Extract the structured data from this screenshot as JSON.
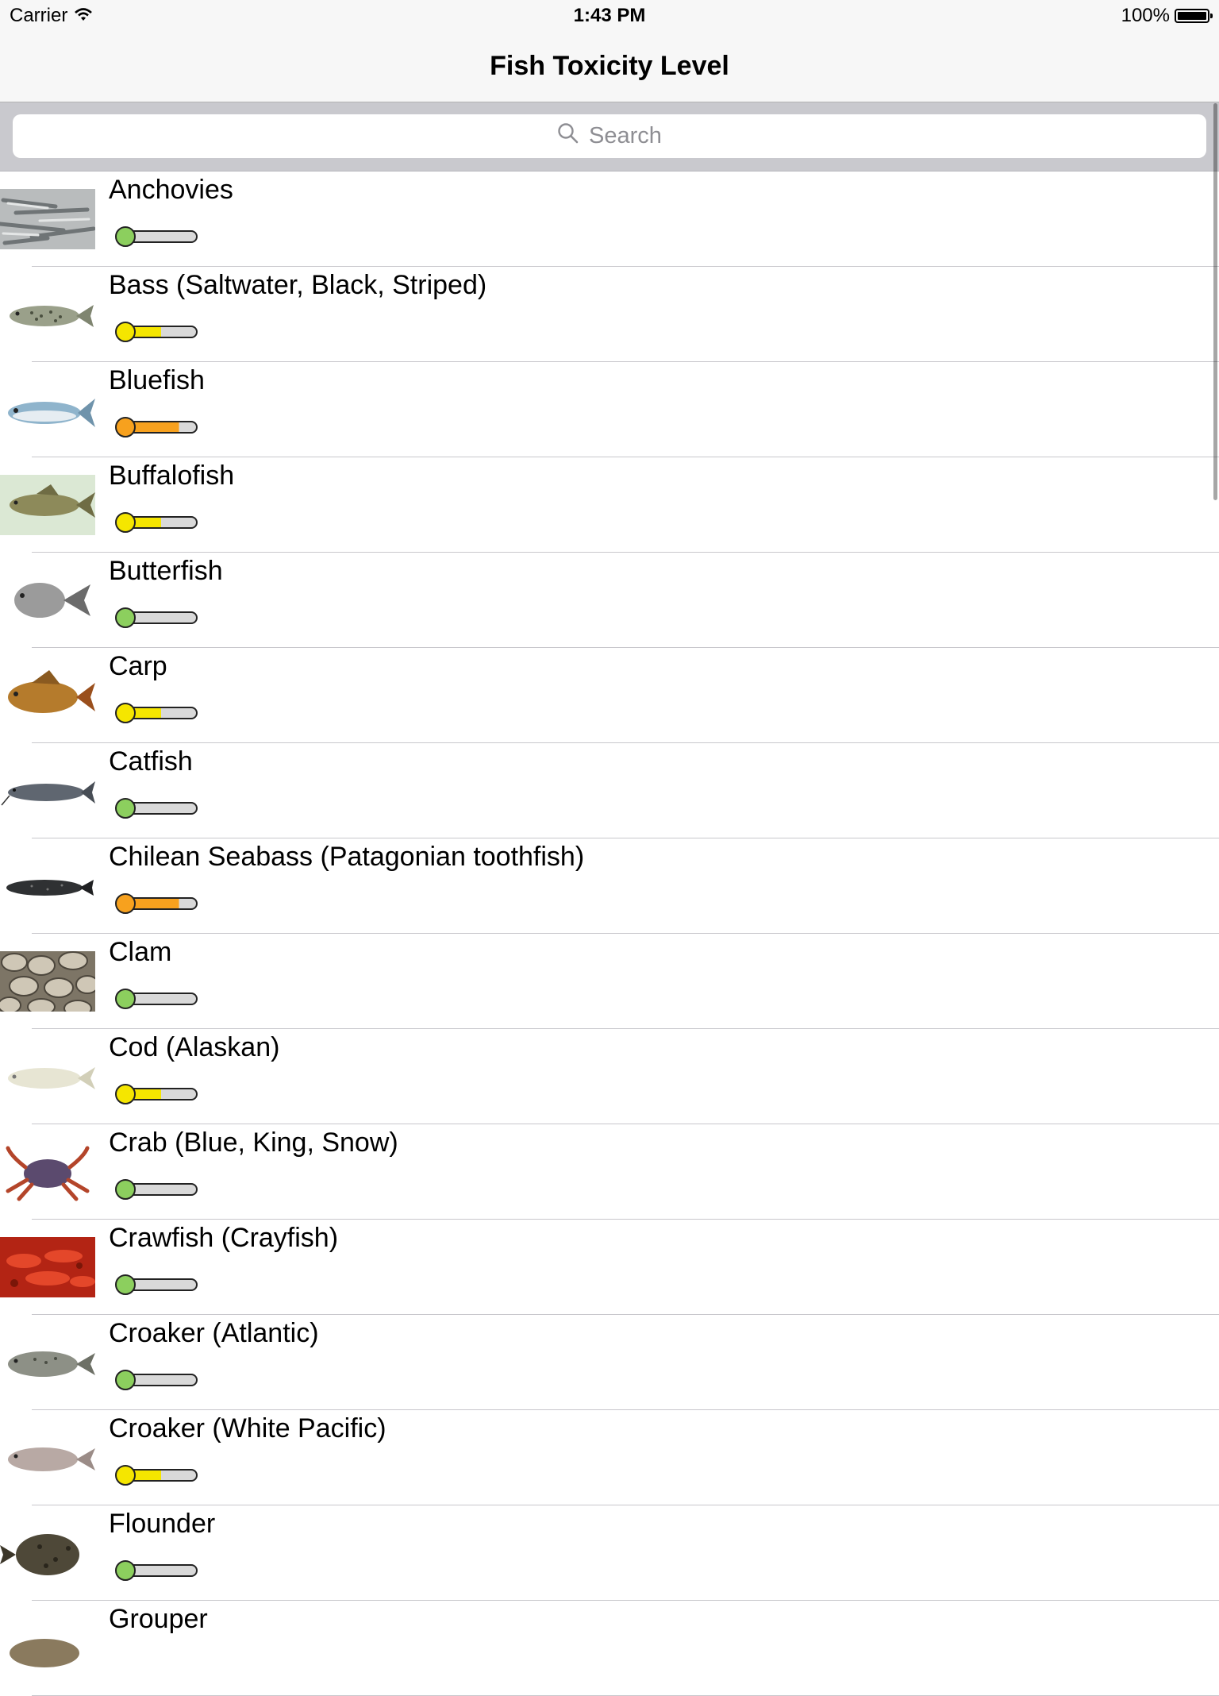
{
  "status_bar": {
    "carrier": "Carrier",
    "time": "1:43 PM",
    "battery": "100%"
  },
  "nav": {
    "title": "Fish Toxicity Level"
  },
  "search": {
    "placeholder": "Search"
  },
  "colors": {
    "green": "#8ccf5e",
    "yellow": "#f5e600",
    "orange": "#f7a11e",
    "track": "#d9d9d9"
  },
  "items": [
    {
      "name": "Anchovies",
      "level": "low",
      "level_fraction": 0.15,
      "image": "anchovies-photo"
    },
    {
      "name": "Bass (Saltwater, Black, Striped)",
      "level": "moderate",
      "level_fraction": 0.5,
      "image": "bass-fish-illustration"
    },
    {
      "name": "Bluefish",
      "level": "high",
      "level_fraction": 0.75,
      "image": "bluefish-illustration"
    },
    {
      "name": "Buffalofish",
      "level": "moderate",
      "level_fraction": 0.5,
      "image": "buffalofish-illustration"
    },
    {
      "name": "Butterfish",
      "level": "low",
      "level_fraction": 0.15,
      "image": "butterfish-illustration"
    },
    {
      "name": "Carp",
      "level": "moderate",
      "level_fraction": 0.5,
      "image": "carp-illustration"
    },
    {
      "name": "Catfish",
      "level": "low",
      "level_fraction": 0.15,
      "image": "catfish-illustration"
    },
    {
      "name": "Chilean Seabass (Patagonian toothfish)",
      "level": "high",
      "level_fraction": 0.75,
      "image": "toothfish-illustration"
    },
    {
      "name": "Clam",
      "level": "low",
      "level_fraction": 0.15,
      "image": "clams-photo"
    },
    {
      "name": "Cod (Alaskan)",
      "level": "moderate",
      "level_fraction": 0.5,
      "image": "cod-illustration"
    },
    {
      "name": "Crab (Blue, King, Snow)",
      "level": "low",
      "level_fraction": 0.15,
      "image": "crab-photo"
    },
    {
      "name": "Crawfish (Crayfish)",
      "level": "low",
      "level_fraction": 0.15,
      "image": "crawfish-photo"
    },
    {
      "name": "Croaker (Atlantic)",
      "level": "low",
      "level_fraction": 0.15,
      "image": "atlantic-croaker-illustration"
    },
    {
      "name": "Croaker (White Pacific)",
      "level": "moderate",
      "level_fraction": 0.5,
      "image": "pacific-croaker-illustration"
    },
    {
      "name": "Flounder",
      "level": "low",
      "level_fraction": 0.15,
      "image": "flounder-illustration"
    },
    {
      "name": "Grouper",
      "level": "",
      "level_fraction": 0,
      "image": "grouper-illustration"
    }
  ]
}
